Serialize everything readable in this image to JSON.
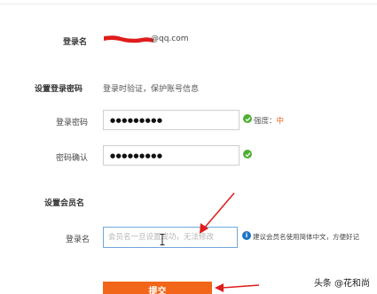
{
  "account": {
    "label": "登录名",
    "email_suffix": "@qq.com"
  },
  "password_section": {
    "title": "设置登录密码",
    "subtitle": "登录时验证，保护账号信息",
    "password_label": "登录密码",
    "password_value": "●●●●●●●●●",
    "strength_label": "强度：",
    "strength_value": "中",
    "confirm_label": "密码确认",
    "confirm_value": "●●●●●●●●●"
  },
  "member_section": {
    "title": "设置会员名",
    "name_label": "登录名",
    "name_placeholder": "会员名一旦设置成功，无法修改",
    "hint": "建议会员名使用简体中文，方便好记"
  },
  "submit": {
    "label": "提交"
  },
  "watermark": "头条 @花和尚",
  "colors": {
    "accent_orange": "#f2661a",
    "success_green": "#4caf32",
    "info_blue": "#1a73c8",
    "annotation_red": "#e01c1c"
  }
}
